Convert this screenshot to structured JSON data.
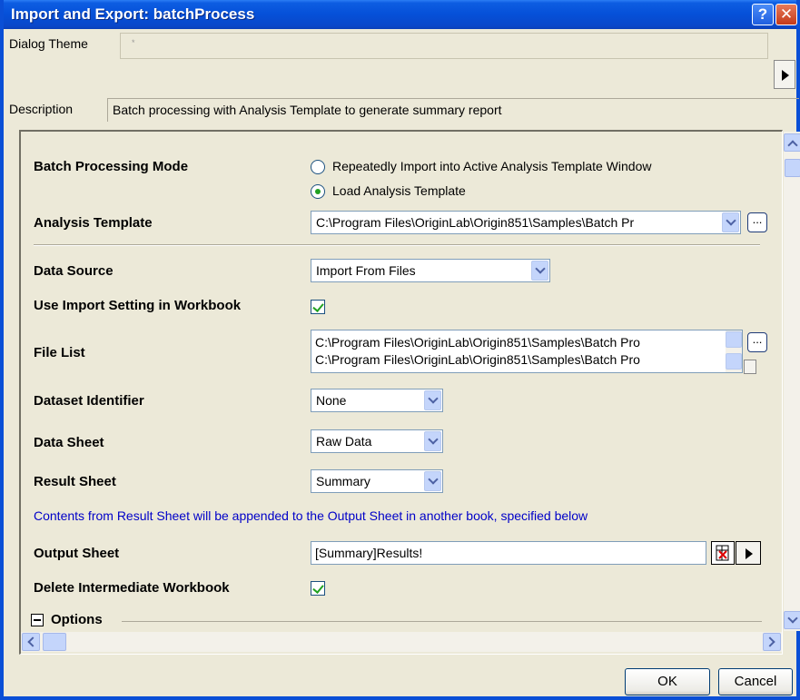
{
  "window": {
    "title": "Import and Export: batchProcess"
  },
  "dialog_theme": {
    "label": "Dialog Theme",
    "value": "*"
  },
  "description": {
    "label": "Description",
    "value": "Batch processing with Analysis Template to generate summary report"
  },
  "batch_mode": {
    "label": "Batch Processing Mode",
    "options": [
      "Repeatedly Import into Active Analysis Template Window",
      "Load Analysis Template"
    ],
    "selected": "Load Analysis Template"
  },
  "analysis_template": {
    "label": "Analysis Template",
    "value": "C:\\Program Files\\OriginLab\\Origin851\\Samples\\Batch Pr"
  },
  "data_source": {
    "label": "Data Source",
    "value": "Import From Files"
  },
  "use_import_setting": {
    "label": "Use Import Setting in Workbook",
    "checked": true
  },
  "file_list": {
    "label": "File List",
    "items": [
      "C:\\Program Files\\OriginLab\\Origin851\\Samples\\Batch Pro",
      "C:\\Program Files\\OriginLab\\Origin851\\Samples\\Batch Pro"
    ]
  },
  "dataset_identifier": {
    "label": "Dataset Identifier",
    "value": "None"
  },
  "data_sheet": {
    "label": "Data Sheet",
    "value": "Raw Data"
  },
  "result_sheet": {
    "label": "Result Sheet",
    "value": "Summary"
  },
  "info_text": "Contents from Result Sheet will be appended to the Output Sheet in another book, specified below",
  "output_sheet": {
    "label": "Output Sheet",
    "value": "[Summary]Results!"
  },
  "delete_intermediate": {
    "label": "Delete Intermediate Workbook",
    "checked": true
  },
  "options_section": {
    "label": "Options"
  },
  "buttons": {
    "ok": "OK",
    "cancel": "Cancel"
  },
  "colors": {
    "title_bar": "#0550d8",
    "info_text": "#0000c8",
    "check": "#21a121"
  }
}
